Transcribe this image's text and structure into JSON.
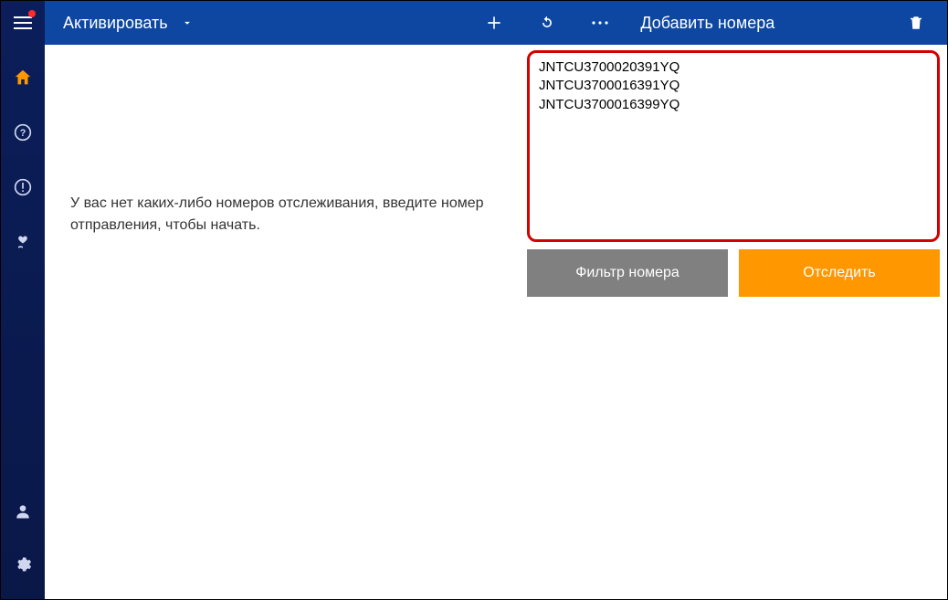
{
  "toolbar": {
    "activate_label": "Активировать",
    "right_title": "Добавить номера"
  },
  "left_pane": {
    "empty_message": "У вас нет каких-либо номеров отслеживания, введите номер отправления, чтобы начать."
  },
  "right_pane": {
    "textarea_value": "JNTCU3700020391YQ\nJNTCU3700016391YQ\nJNTCU3700016399YQ",
    "filter_button": "Фильтр номера",
    "track_button": "Отследить"
  },
  "sidebar": {
    "items": [
      "menu",
      "home",
      "help",
      "alert",
      "donate"
    ],
    "bottom_items": [
      "user",
      "settings"
    ]
  },
  "colors": {
    "accent": "#ff9800",
    "brand": "#0d47a1",
    "highlight_border": "#d40000",
    "sidebar_bg": "#0b1e5a"
  }
}
